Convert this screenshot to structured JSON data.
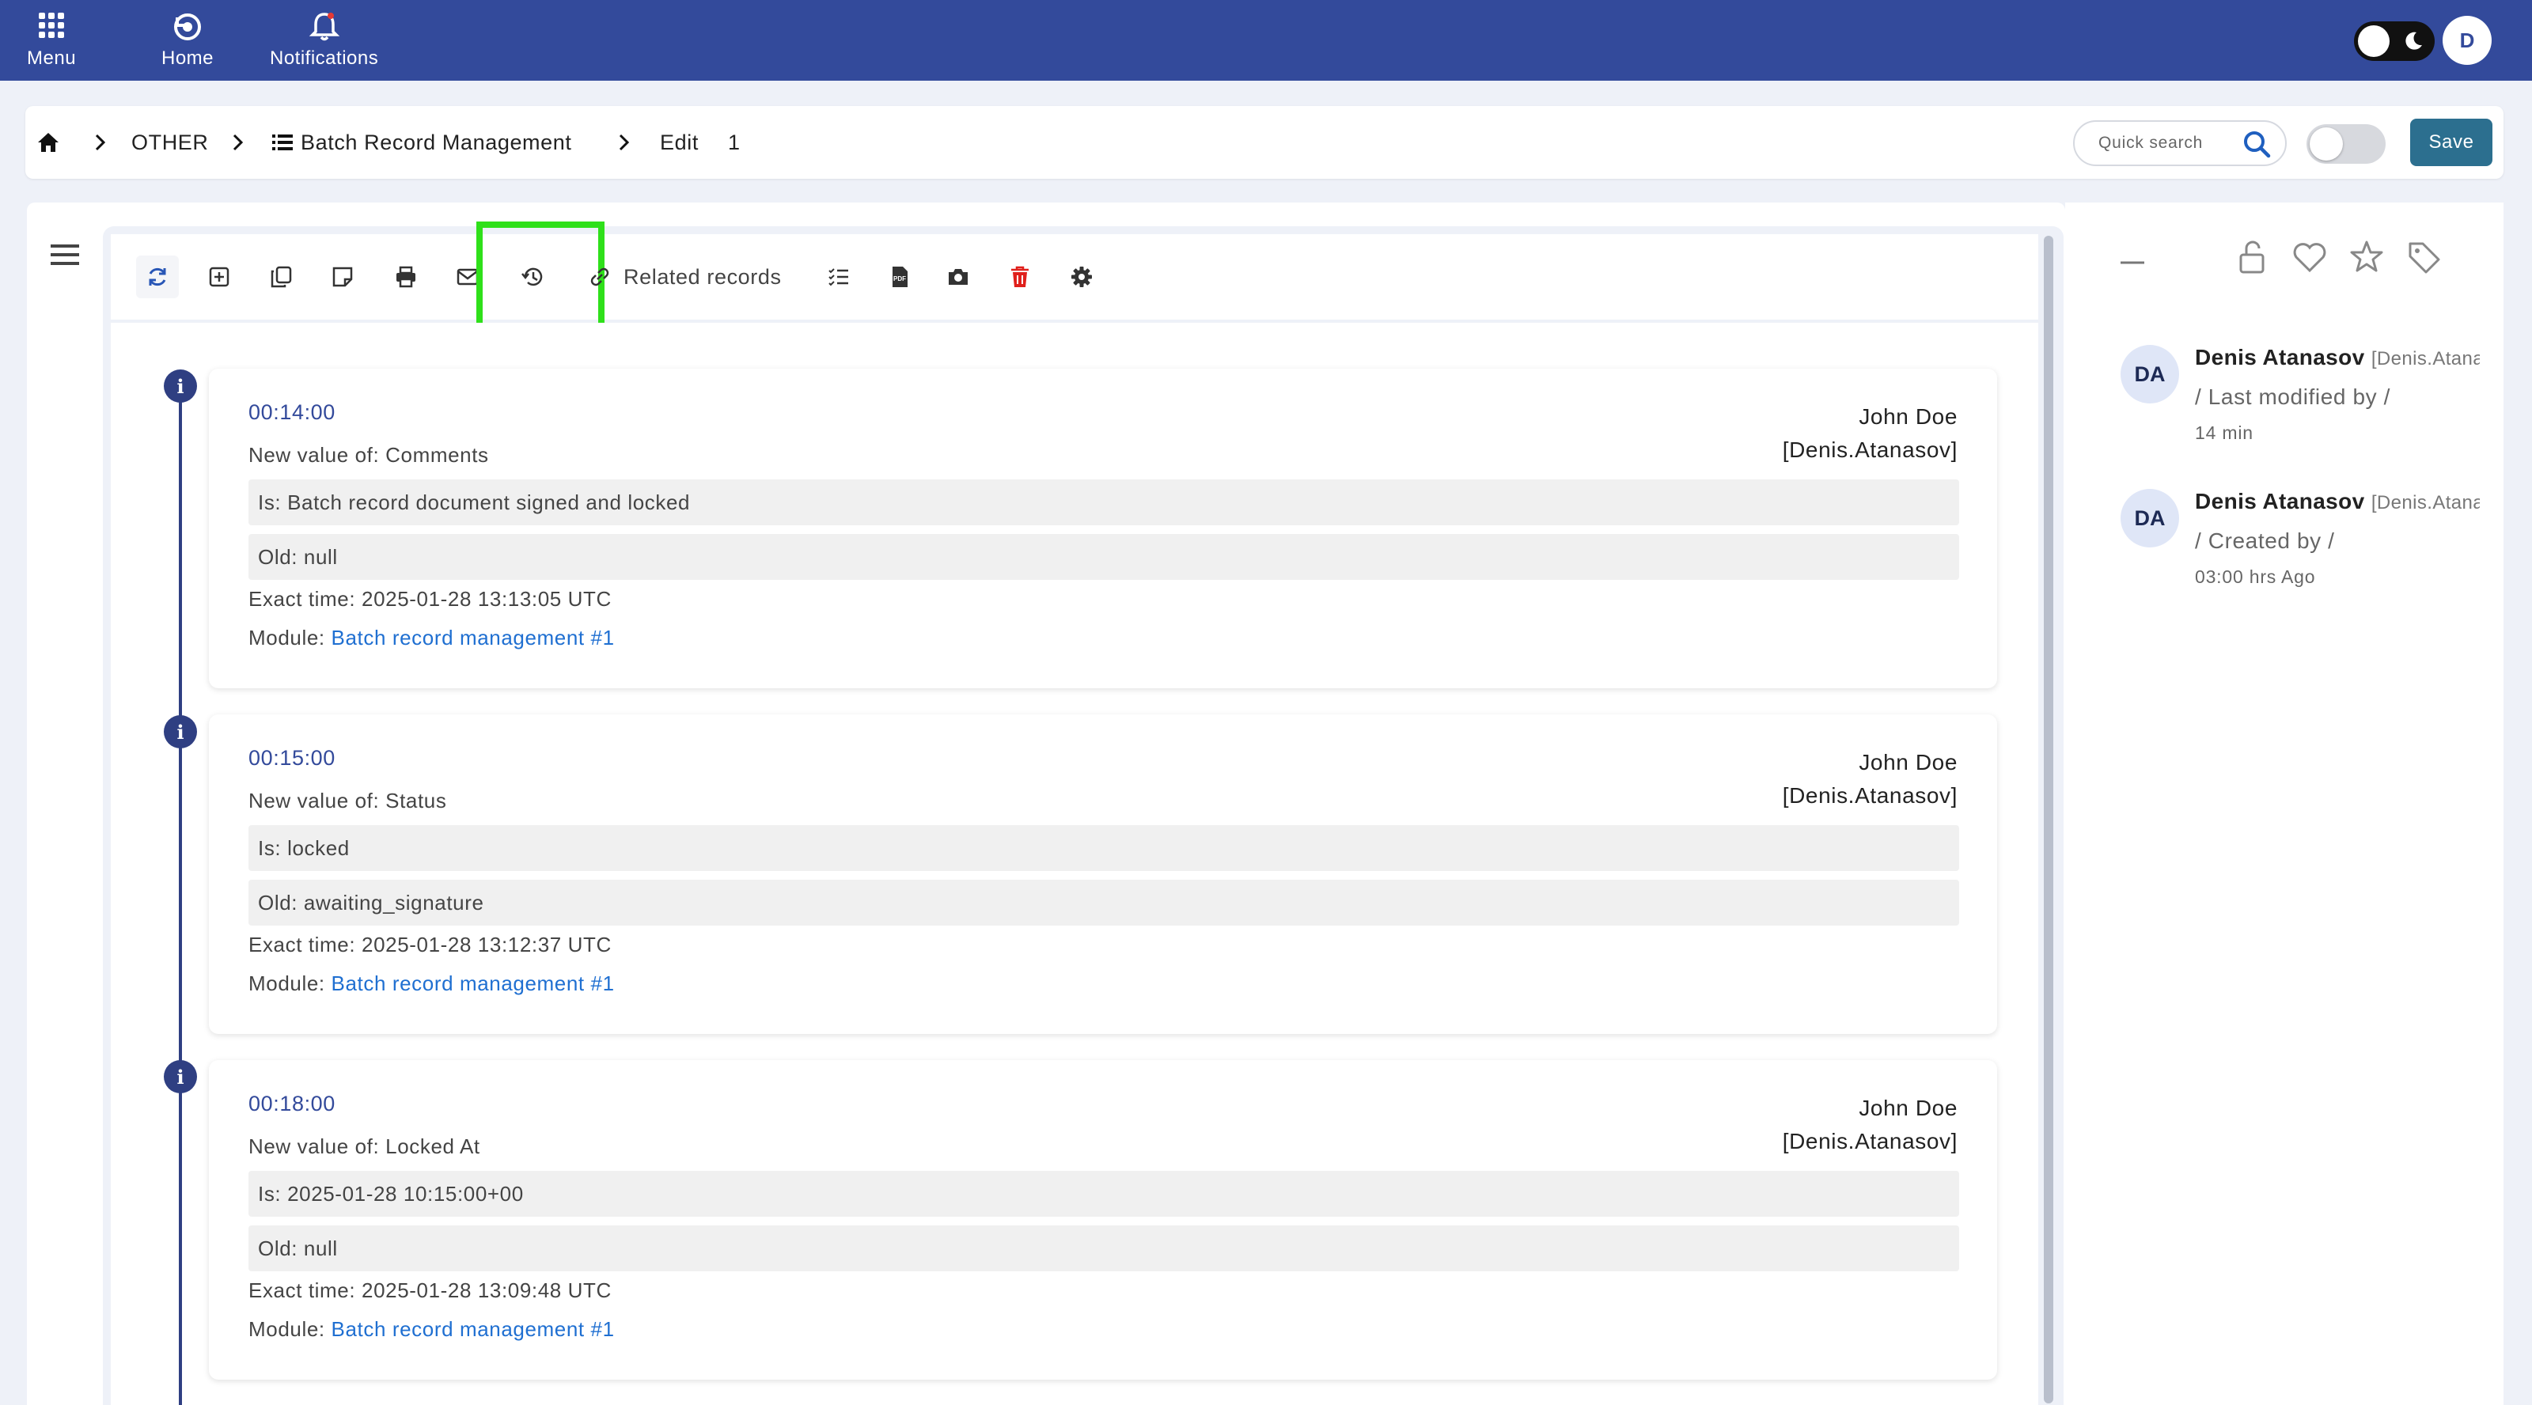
{
  "topbar": {
    "menu_label": "Menu",
    "home_label": "Home",
    "notifications_label": "Notifications",
    "user_initial": "D"
  },
  "breadcrumb": {
    "section": "OTHER",
    "module": "Batch Record Management",
    "action": "Edit",
    "record_id": "1"
  },
  "search": {
    "placeholder": "Quick search"
  },
  "header": {
    "save_label": "Save"
  },
  "toolbar": {
    "related_records_label": "Related records",
    "icons": [
      "refresh-icon",
      "add-icon",
      "duplicate-icon",
      "note-icon",
      "print-icon",
      "email-icon",
      "history-icon",
      "link-icon",
      "checklist-icon",
      "pdf-icon",
      "camera-icon",
      "delete-icon",
      "settings-icon"
    ],
    "highlight_color": "#2fe01a"
  },
  "history": {
    "entries": [
      {
        "time": "00:14:00",
        "user_name": "John Doe",
        "user_handle": "[Denis.Atanasov]",
        "field": "New value of: Comments",
        "is_value": "Is: Batch record document signed and locked",
        "old_value": "Old: null",
        "exact_time": "Exact time: 2025-01-28 13:13:05 UTC",
        "module_prefix": "Module: ",
        "module_link": "Batch record management #1"
      },
      {
        "time": "00:15:00",
        "user_name": "John Doe",
        "user_handle": "[Denis.Atanasov]",
        "field": "New value of: Status",
        "is_value": "Is: locked",
        "old_value": "Old: awaiting_signature",
        "exact_time": "Exact time: 2025-01-28 13:12:37 UTC",
        "module_prefix": "Module: ",
        "module_link": "Batch record management #1"
      },
      {
        "time": "00:18:00",
        "user_name": "John Doe",
        "user_handle": "[Denis.Atanasov]",
        "field": "New value of: Locked At",
        "is_value": "Is: 2025-01-28 10:15:00+00",
        "old_value": "Old: null",
        "exact_time": "Exact time: 2025-01-28 13:09:48 UTC",
        "module_prefix": "Module: ",
        "module_link": "Batch record management #1"
      }
    ]
  },
  "sidebar": {
    "icons": [
      "collapse-icon",
      "unlock-icon",
      "heart-icon",
      "star-icon",
      "tag-icon"
    ],
    "activity": [
      {
        "initials": "DA",
        "name": "Denis Atanasov",
        "handle": "[Denis.Atanasov]",
        "action": "/ Last modified by /",
        "time": "14 min"
      },
      {
        "initials": "DA",
        "name": "Denis Atanasov",
        "handle": "[Denis.Atanasov]",
        "action": "/ Created by /",
        "time": "03:00 hrs Ago"
      }
    ]
  },
  "colors": {
    "topbar": "#334a9b",
    "save_button": "#2c6f8f",
    "timeline": "#2f3f82",
    "link": "#1f6fd1",
    "delete": "#e0201c"
  }
}
